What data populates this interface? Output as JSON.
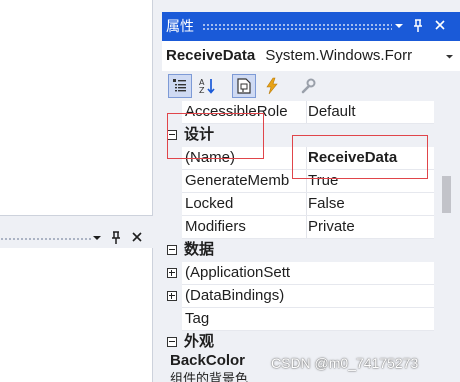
{
  "left_panel": {
    "bar_icons": [
      "chevron-down-icon",
      "pin-icon",
      "close-icon"
    ]
  },
  "properties_window": {
    "title": "属性",
    "title_icons": [
      "chevron-down-icon",
      "pin-icon",
      "close-icon"
    ],
    "object_name": "ReceiveData",
    "object_type": "System.Windows.Forr",
    "toolbar": [
      "categorized-icon",
      "alphabetical-icon",
      "properties-icon",
      "events-icon",
      "property-pages-icon"
    ],
    "rows": [
      {
        "kind": "prop",
        "name": "AccessibleRole",
        "value": "Default"
      },
      {
        "kind": "category",
        "name": "设计",
        "expanded": true
      },
      {
        "kind": "prop",
        "name": "(Name)",
        "value": "ReceiveData",
        "value_bold": true
      },
      {
        "kind": "prop",
        "name": "GenerateMemb",
        "value": "True"
      },
      {
        "kind": "prop",
        "name": "Locked",
        "value": "False"
      },
      {
        "kind": "prop",
        "name": "Modifiers",
        "value": "Private"
      },
      {
        "kind": "category",
        "name": "数据",
        "expanded": true
      },
      {
        "kind": "prop",
        "name": "(ApplicationSett",
        "value": "",
        "expandable": true
      },
      {
        "kind": "prop",
        "name": "(DataBindings)",
        "value": "",
        "expandable": true
      },
      {
        "kind": "prop",
        "name": "Tag",
        "value": ""
      },
      {
        "kind": "category",
        "name": "外观",
        "expanded": true
      }
    ],
    "description": {
      "title": "BackColor",
      "text": "组件的背景色"
    }
  },
  "watermark": "CSDN @m0_74175273",
  "colors": {
    "title_bar": "#1a5ad8",
    "highlight_box": "#e0454a",
    "panel_bg": "#eef0f5"
  }
}
